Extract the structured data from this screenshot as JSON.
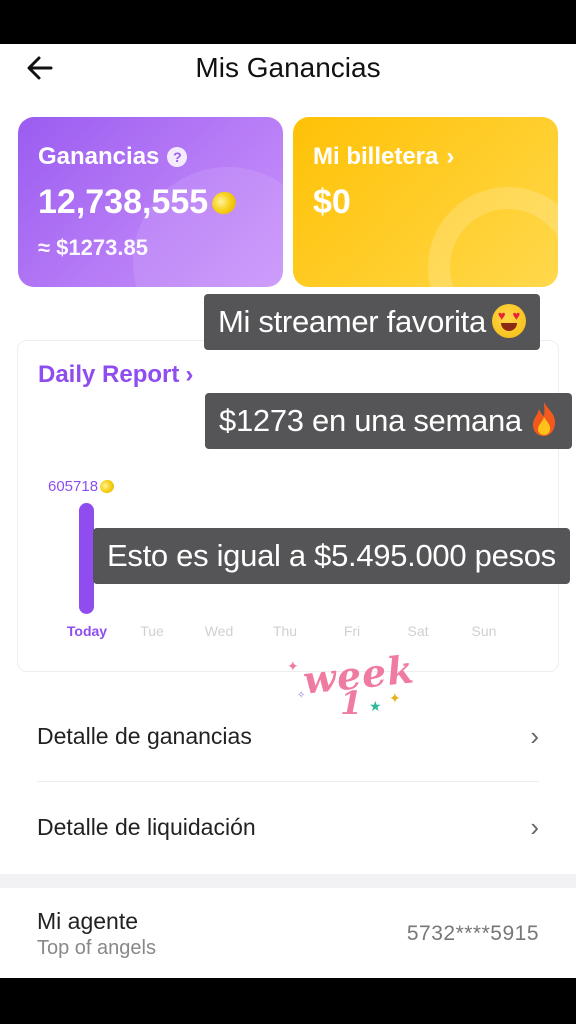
{
  "header": {
    "title": "Mis Ganancias"
  },
  "earnings_card": {
    "label": "Ganancias",
    "amount": "12,738,555",
    "usd": "≈ $1273.85"
  },
  "wallet_card": {
    "label": "Mi billetera",
    "amount": "$0"
  },
  "daily_report": {
    "title": "Daily Report",
    "bar_value": "605718",
    "days": [
      {
        "label": "Today",
        "active": true
      },
      {
        "label": "Tue"
      },
      {
        "label": "Wed"
      },
      {
        "label": "Thu"
      },
      {
        "label": "Fri"
      },
      {
        "label": "Sat"
      },
      {
        "label": "Sun"
      }
    ]
  },
  "captions": [
    "Mi streamer favorita",
    "$1273 en una semana",
    "Esto es igual a $5.495.000 pesos"
  ],
  "sticker": {
    "text": "week",
    "number": "1"
  },
  "menu": [
    {
      "label": "Detalle de ganancias"
    },
    {
      "label": "Detalle de liquidación"
    }
  ],
  "agent": {
    "title": "Mi agente",
    "subtitle": "Top of angels",
    "id": "5732****5915"
  },
  "colors": {
    "primary_purple": "#8f4df0",
    "wallet_yellow": "#ffc107",
    "caption_bg": "#555557"
  }
}
